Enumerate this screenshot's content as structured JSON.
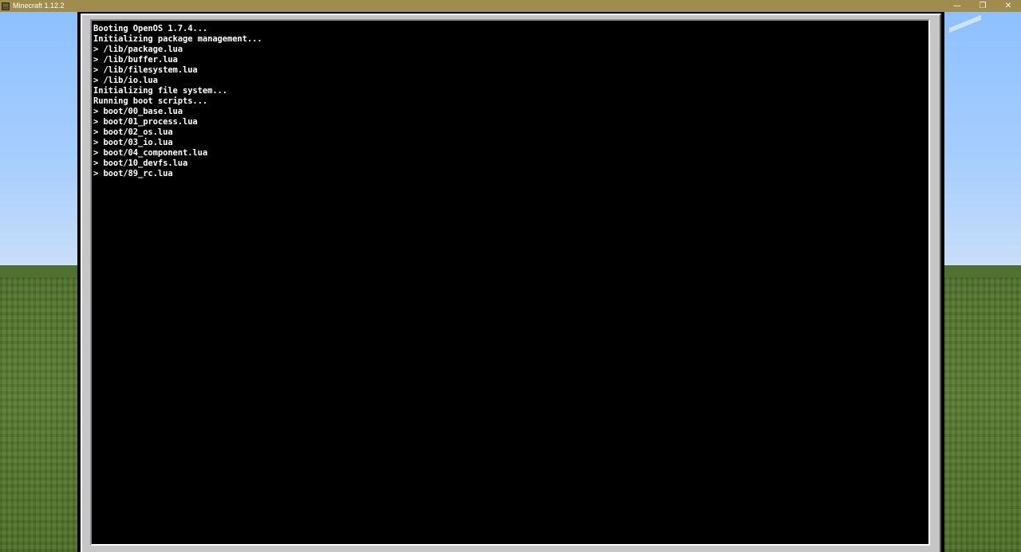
{
  "window": {
    "title": "Minecraft 1.12.2",
    "controls": {
      "minimize": "—",
      "restore": "❐",
      "close": "✕"
    }
  },
  "terminal": {
    "lines": [
      "Booting OpenOS 1.7.4...",
      "Initializing package management...",
      "> /lib/package.lua",
      "> /lib/buffer.lua",
      "> /lib/filesystem.lua",
      "> /lib/io.lua",
      "Initializing file system...",
      "Running boot scripts...",
      "> boot/00_base.lua",
      "> boot/01_process.lua",
      "> boot/02_os.lua",
      "> boot/03_io.lua",
      "> boot/04_component.lua",
      "> boot/10_devfs.lua",
      "> boot/89_rc.lua"
    ]
  },
  "colors": {
    "titlebar": "#a08c4c",
    "terminal_bg": "#000000",
    "terminal_text": "#ffffff",
    "gui_bezel": "#c6c6c6"
  }
}
